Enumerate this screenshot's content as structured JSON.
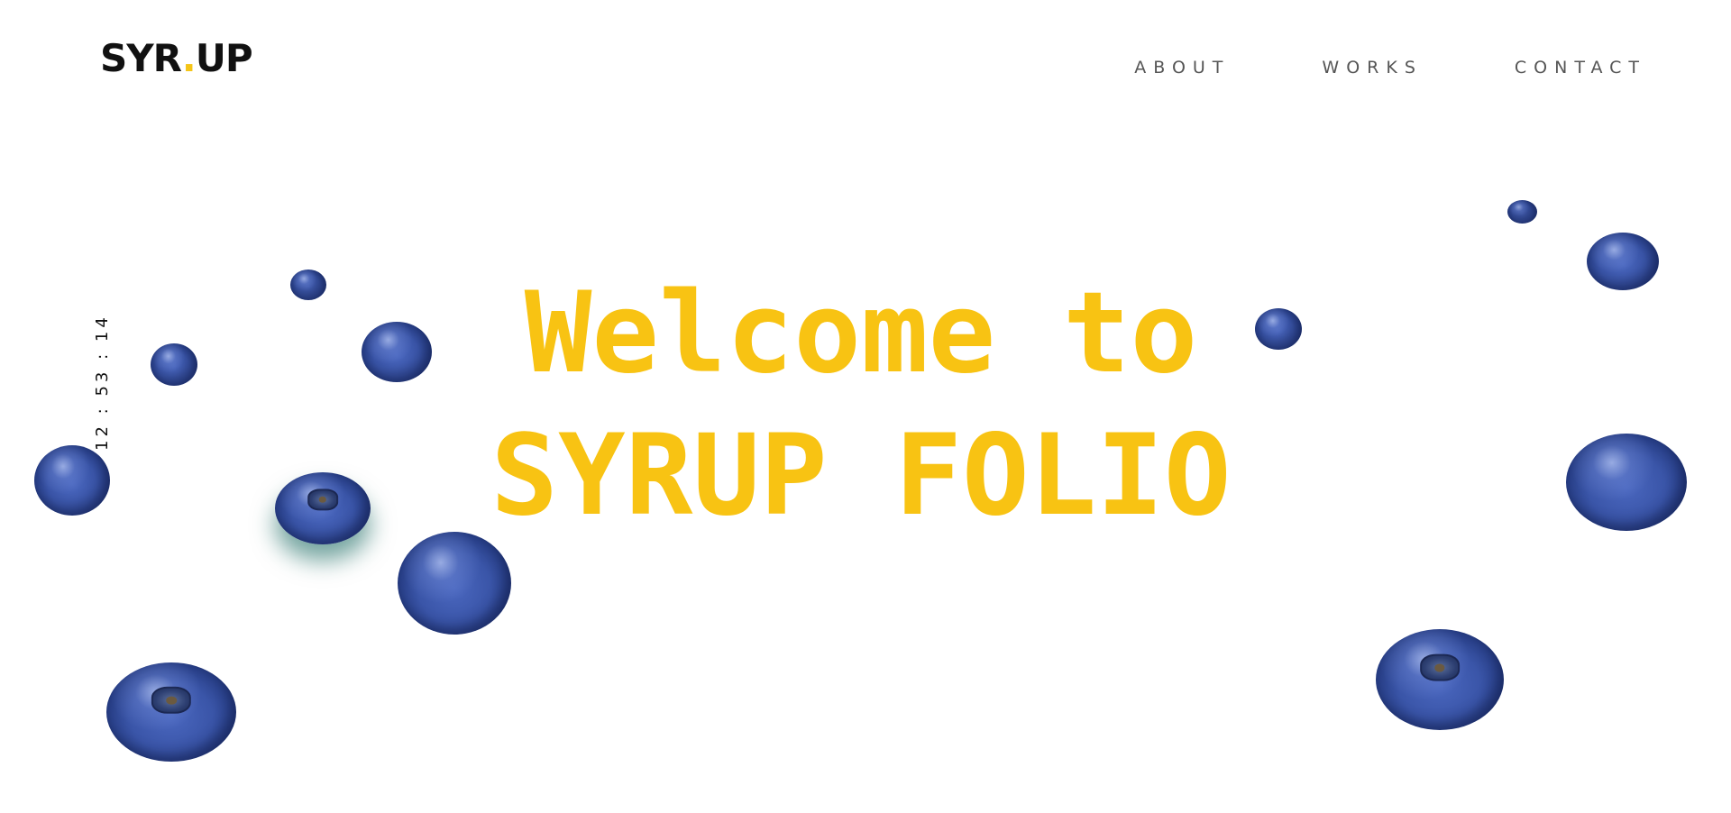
{
  "header": {
    "logo": {
      "part1": "SYR",
      "dot": ".",
      "part2": "UP"
    },
    "nav": [
      {
        "label": "ABOUT"
      },
      {
        "label": "WORKS"
      },
      {
        "label": "CONTACT"
      }
    ]
  },
  "clock": {
    "hours": "12",
    "minutes": "53",
    "seconds": "14",
    "separator": ":"
  },
  "hero": {
    "line1": "Welcome to",
    "line2": "SYRUP FOLIO"
  },
  "colors": {
    "accent": "#f8c313",
    "logo": "#111111",
    "nav": "#555555",
    "berry": "#3a55a8"
  },
  "decor": {
    "icon": "blueberry-icon",
    "count": 14
  }
}
